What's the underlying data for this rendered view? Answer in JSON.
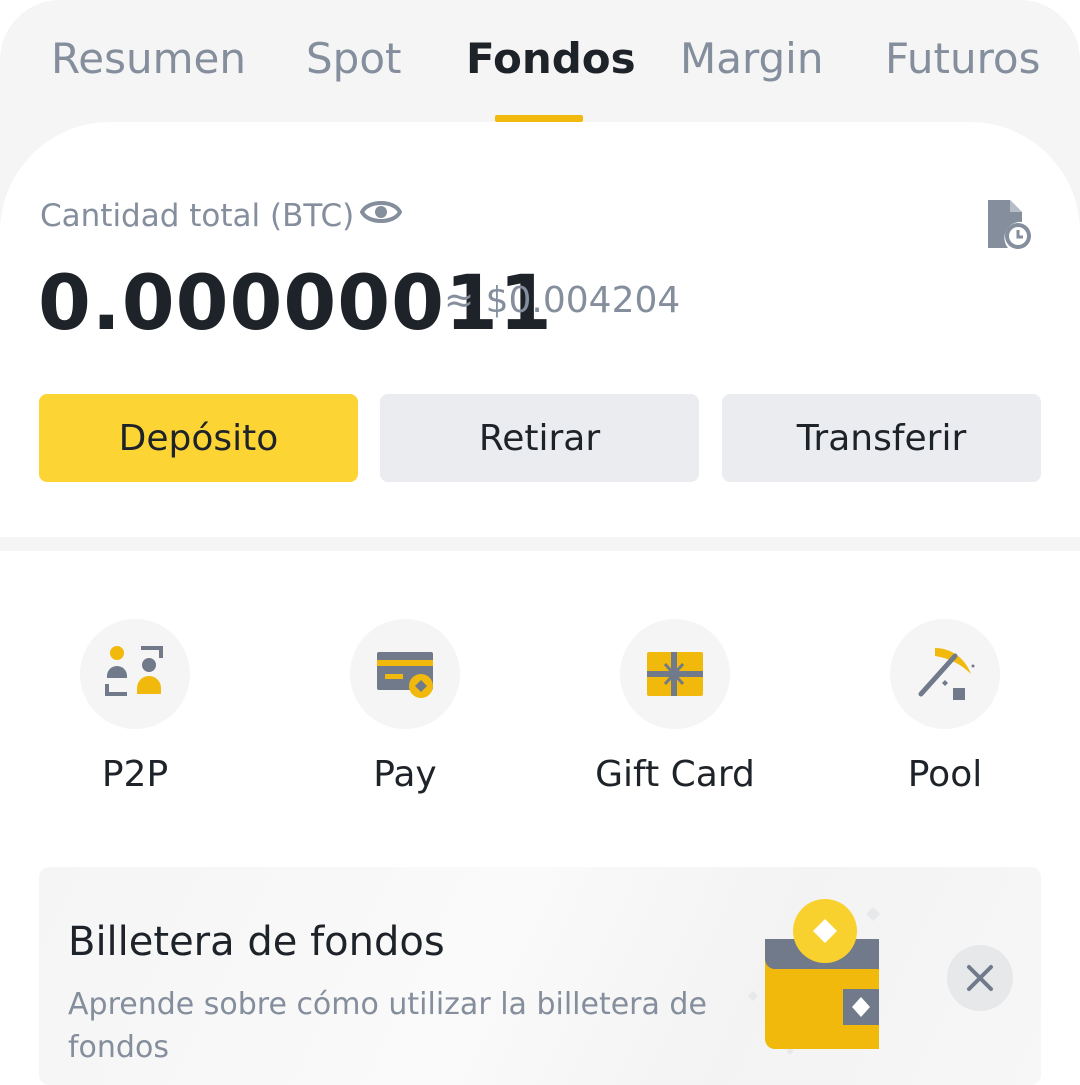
{
  "tabs": [
    {
      "label": "Resumen",
      "active": false
    },
    {
      "label": "Spot",
      "active": false
    },
    {
      "label": "Fondos",
      "active": true
    },
    {
      "label": "Margin",
      "active": false
    },
    {
      "label": "Futuros",
      "active": false
    }
  ],
  "balance": {
    "label": "Cantidad total (BTC)",
    "value": "0.00000011",
    "approx_fiat": "≈ $0.004204",
    "visibility_icon": "eye-icon",
    "history_icon": "transaction-history-icon"
  },
  "actions": {
    "deposit": "Depósito",
    "withdraw": "Retirar",
    "transfer": "Transferir"
  },
  "shortcuts": [
    {
      "label": "P2P",
      "icon": "p2p-users-icon"
    },
    {
      "label": "Pay",
      "icon": "pay-card-icon"
    },
    {
      "label": "Gift Card",
      "icon": "gift-card-icon"
    },
    {
      "label": "Pool",
      "icon": "mining-pickaxe-icon"
    }
  ],
  "banner": {
    "title": "Billetera de fondos",
    "description": "Aprende sobre cómo utilizar la billetera de fondos",
    "illustration": "wallet-coin-illustration",
    "close_icon": "close-icon"
  },
  "colors": {
    "accent": "#fcd535",
    "brand_yellow": "#f0b90b",
    "text_primary": "#1e2329",
    "text_secondary": "#848e9c",
    "button_secondary": "#eaecef",
    "background": "#f5f5f5"
  }
}
